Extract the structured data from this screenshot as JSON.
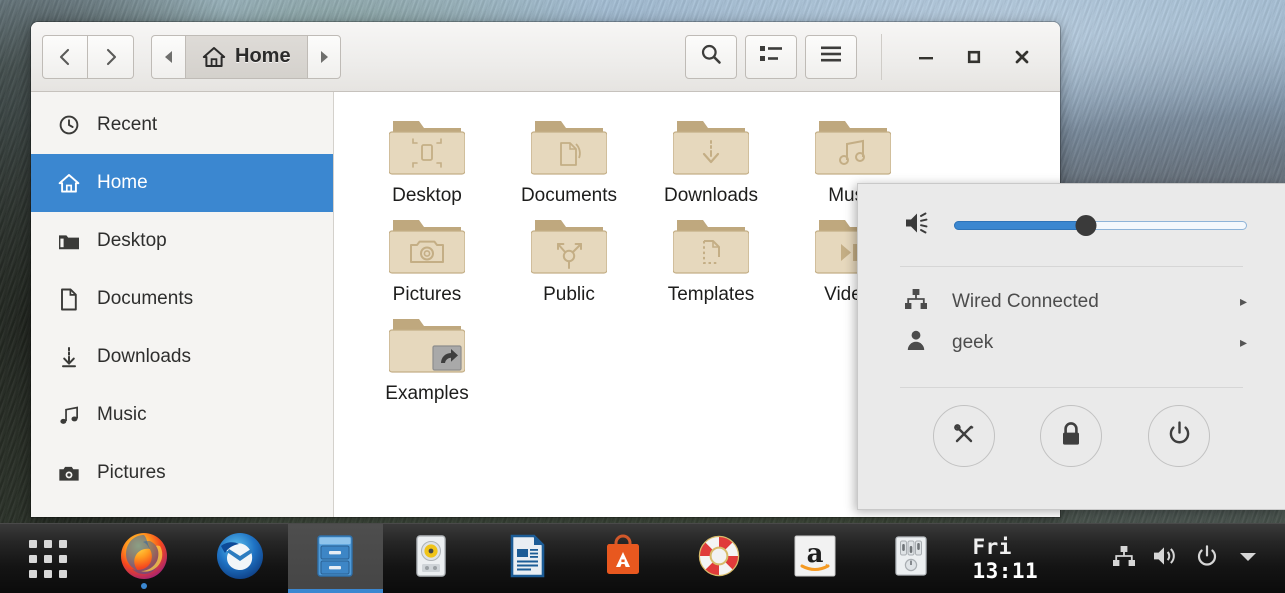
{
  "window": {
    "title": "Home",
    "nav": {
      "back": "‹",
      "forward": "›"
    },
    "pathbar": {
      "prev": "◂",
      "crumb_label": "Home",
      "next": "▸"
    },
    "toolbar": {
      "search_label": "search-icon",
      "list_view_label": "list-view-icon",
      "menu_label": "hamburger-menu-icon"
    },
    "controls": {
      "minimize": "–",
      "maximize": "□",
      "close": "✕"
    }
  },
  "sidebar": {
    "items": [
      {
        "label": "Recent",
        "icon": "clock-icon",
        "active": false
      },
      {
        "label": "Home",
        "icon": "home-icon",
        "active": true
      },
      {
        "label": "Desktop",
        "icon": "folder-icon",
        "active": false
      },
      {
        "label": "Documents",
        "icon": "document-icon",
        "active": false
      },
      {
        "label": "Downloads",
        "icon": "download-icon",
        "active": false
      },
      {
        "label": "Music",
        "icon": "music-note-icon",
        "active": false
      },
      {
        "label": "Pictures",
        "icon": "camera-icon",
        "active": false
      }
    ]
  },
  "files": [
    {
      "label": "Desktop",
      "emblem": "desktop"
    },
    {
      "label": "Documents",
      "emblem": "documents"
    },
    {
      "label": "Downloads",
      "emblem": "downloads"
    },
    {
      "label": "Music",
      "emblem": "music"
    },
    {
      "label": "Pictures",
      "emblem": "pictures"
    },
    {
      "label": "Public",
      "emblem": "public"
    },
    {
      "label": "Templates",
      "emblem": "templates"
    },
    {
      "label": "Videos",
      "emblem": "videos"
    },
    {
      "label": "Examples",
      "emblem": "symlink"
    }
  ],
  "popup": {
    "volume": {
      "icon": "volume-icon",
      "value": 45
    },
    "items": [
      {
        "label": "Wired Connected",
        "icon": "network-wired-icon",
        "arrow": "▸"
      },
      {
        "label": "geek",
        "icon": "user-icon",
        "arrow": "▸"
      }
    ],
    "actions": [
      {
        "name": "settings",
        "icon": "tools-icon"
      },
      {
        "name": "lock",
        "icon": "lock-icon"
      },
      {
        "name": "power",
        "icon": "power-icon"
      }
    ]
  },
  "taskbar": {
    "launcher": "apps-grid-icon",
    "apps": [
      {
        "name": "firefox",
        "state": "running"
      },
      {
        "name": "thunderbird",
        "state": "idle"
      },
      {
        "name": "files",
        "state": "active"
      },
      {
        "name": "rhythmbox",
        "state": "idle"
      },
      {
        "name": "libreoffice-writer",
        "state": "idle"
      },
      {
        "name": "ubuntu-software",
        "state": "idle"
      },
      {
        "name": "help",
        "state": "idle"
      },
      {
        "name": "amazon",
        "state": "idle"
      },
      {
        "name": "audio-mixer",
        "state": "idle"
      }
    ],
    "clock": {
      "day": "Fri",
      "time": "13:11"
    },
    "tray": [
      {
        "name": "network-wired-icon"
      },
      {
        "name": "volume-icon"
      },
      {
        "name": "power-icon"
      },
      {
        "name": "chevron-down-icon"
      }
    ]
  },
  "colors": {
    "accent": "#3b87d0",
    "window_bg": "#f5f4f2",
    "folder": "#e3d4b8",
    "taskbar": "#141414"
  }
}
